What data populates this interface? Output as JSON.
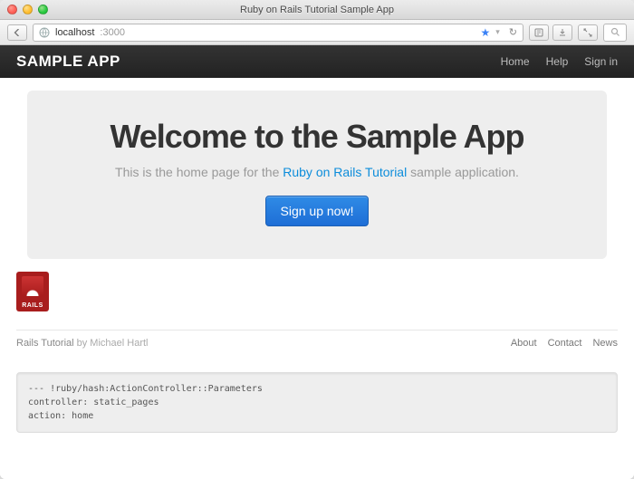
{
  "window": {
    "title": "Ruby on Rails Tutorial Sample App"
  },
  "urlbar": {
    "host": "localhost",
    "port": ":3000"
  },
  "nav": {
    "brand": "SAMPLE APP",
    "links": [
      "Home",
      "Help",
      "Sign in"
    ]
  },
  "hero": {
    "heading": "Welcome to the Sample App",
    "lead_pre": "This is the home page for the ",
    "lead_link": "Ruby on Rails Tutorial",
    "lead_post": " sample application.",
    "signup_label": "Sign up now!"
  },
  "logo": {
    "label": "RAILS"
  },
  "footer": {
    "site": "Rails Tutorial",
    "by": " by Michael Hartl",
    "links": [
      "About",
      "Contact",
      "News"
    ]
  },
  "debug": "--- !ruby/hash:ActionController::Parameters\ncontroller: static_pages\naction: home"
}
